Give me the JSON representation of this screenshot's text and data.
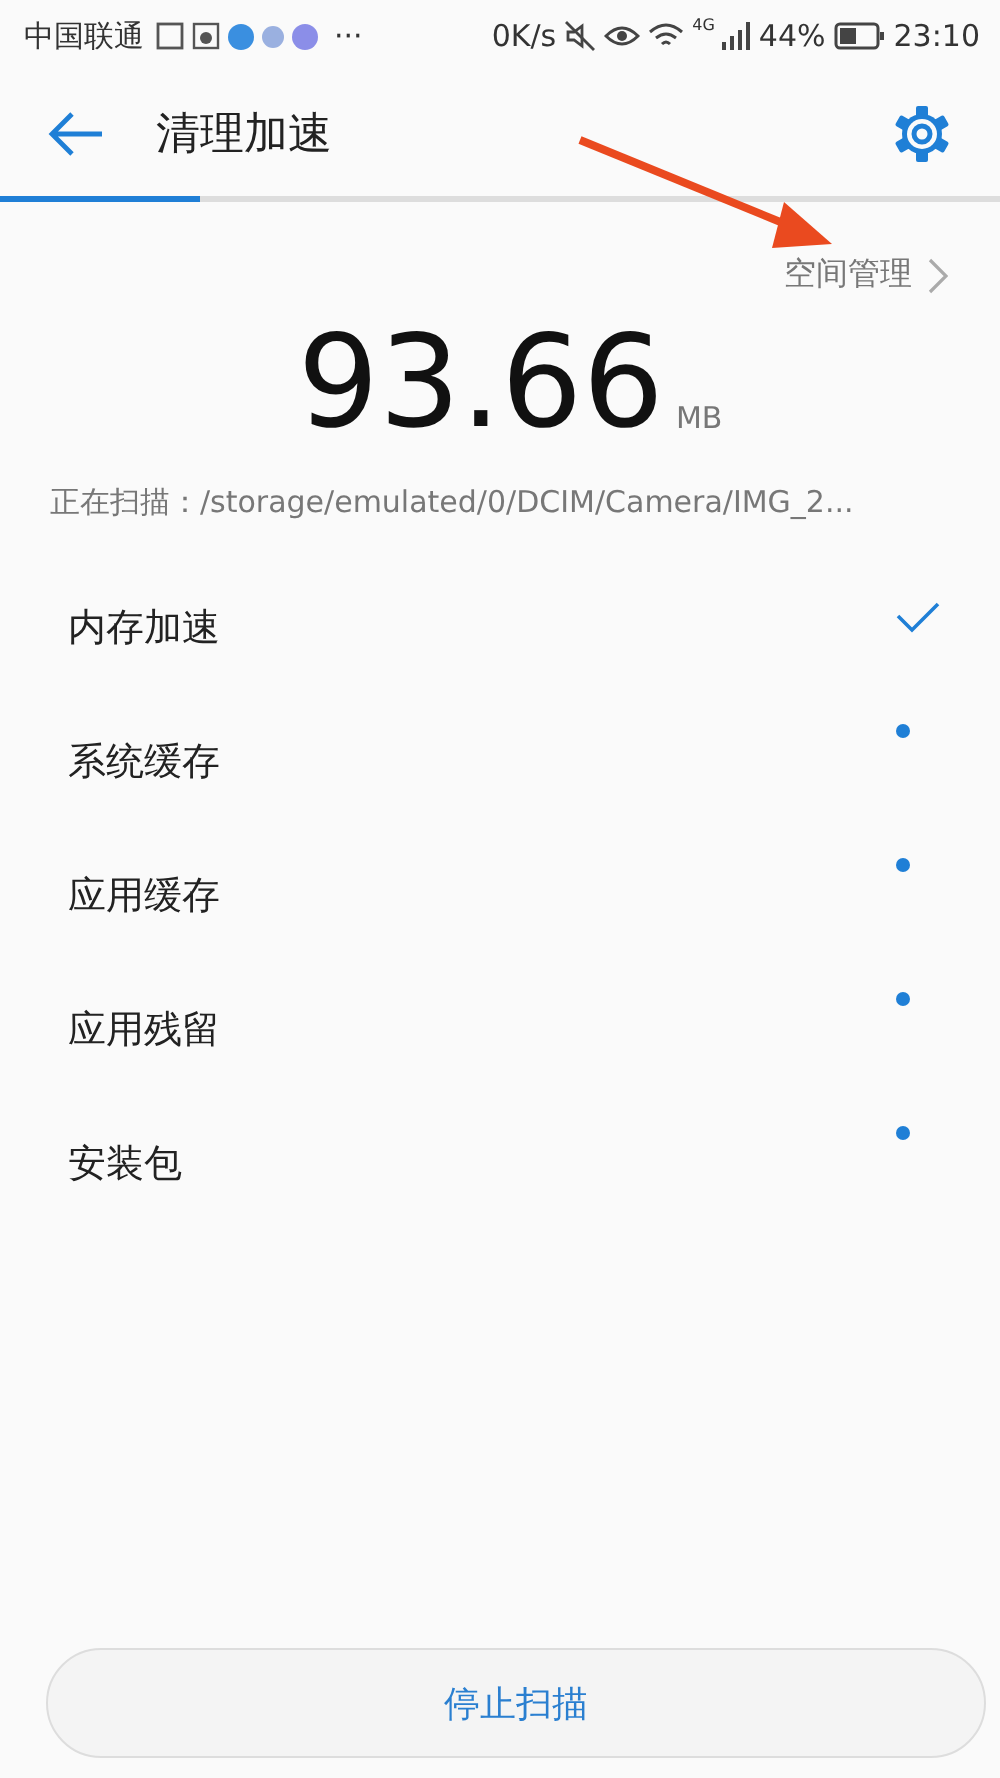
{
  "status_bar": {
    "carrier": "中国联通",
    "more": "···",
    "speed": "0K/s",
    "network": "4G",
    "battery": "44%",
    "time": "23:10"
  },
  "header": {
    "title": "清理加速"
  },
  "progress": {
    "level": 0.2
  },
  "space_link": "空间管理",
  "total": {
    "value": "93.66",
    "unit": "MB"
  },
  "scanning": "正在扫描：/storage/emulated/0/DCIM/Camera/IMG_2...",
  "items": [
    {
      "label": "内存加速",
      "done": true
    },
    {
      "label": "系统缓存",
      "done": false
    },
    {
      "label": "应用缓存",
      "done": false
    },
    {
      "label": "应用残留",
      "done": false
    },
    {
      "label": "安装包",
      "done": false
    }
  ],
  "stop_button": "停止扫描"
}
